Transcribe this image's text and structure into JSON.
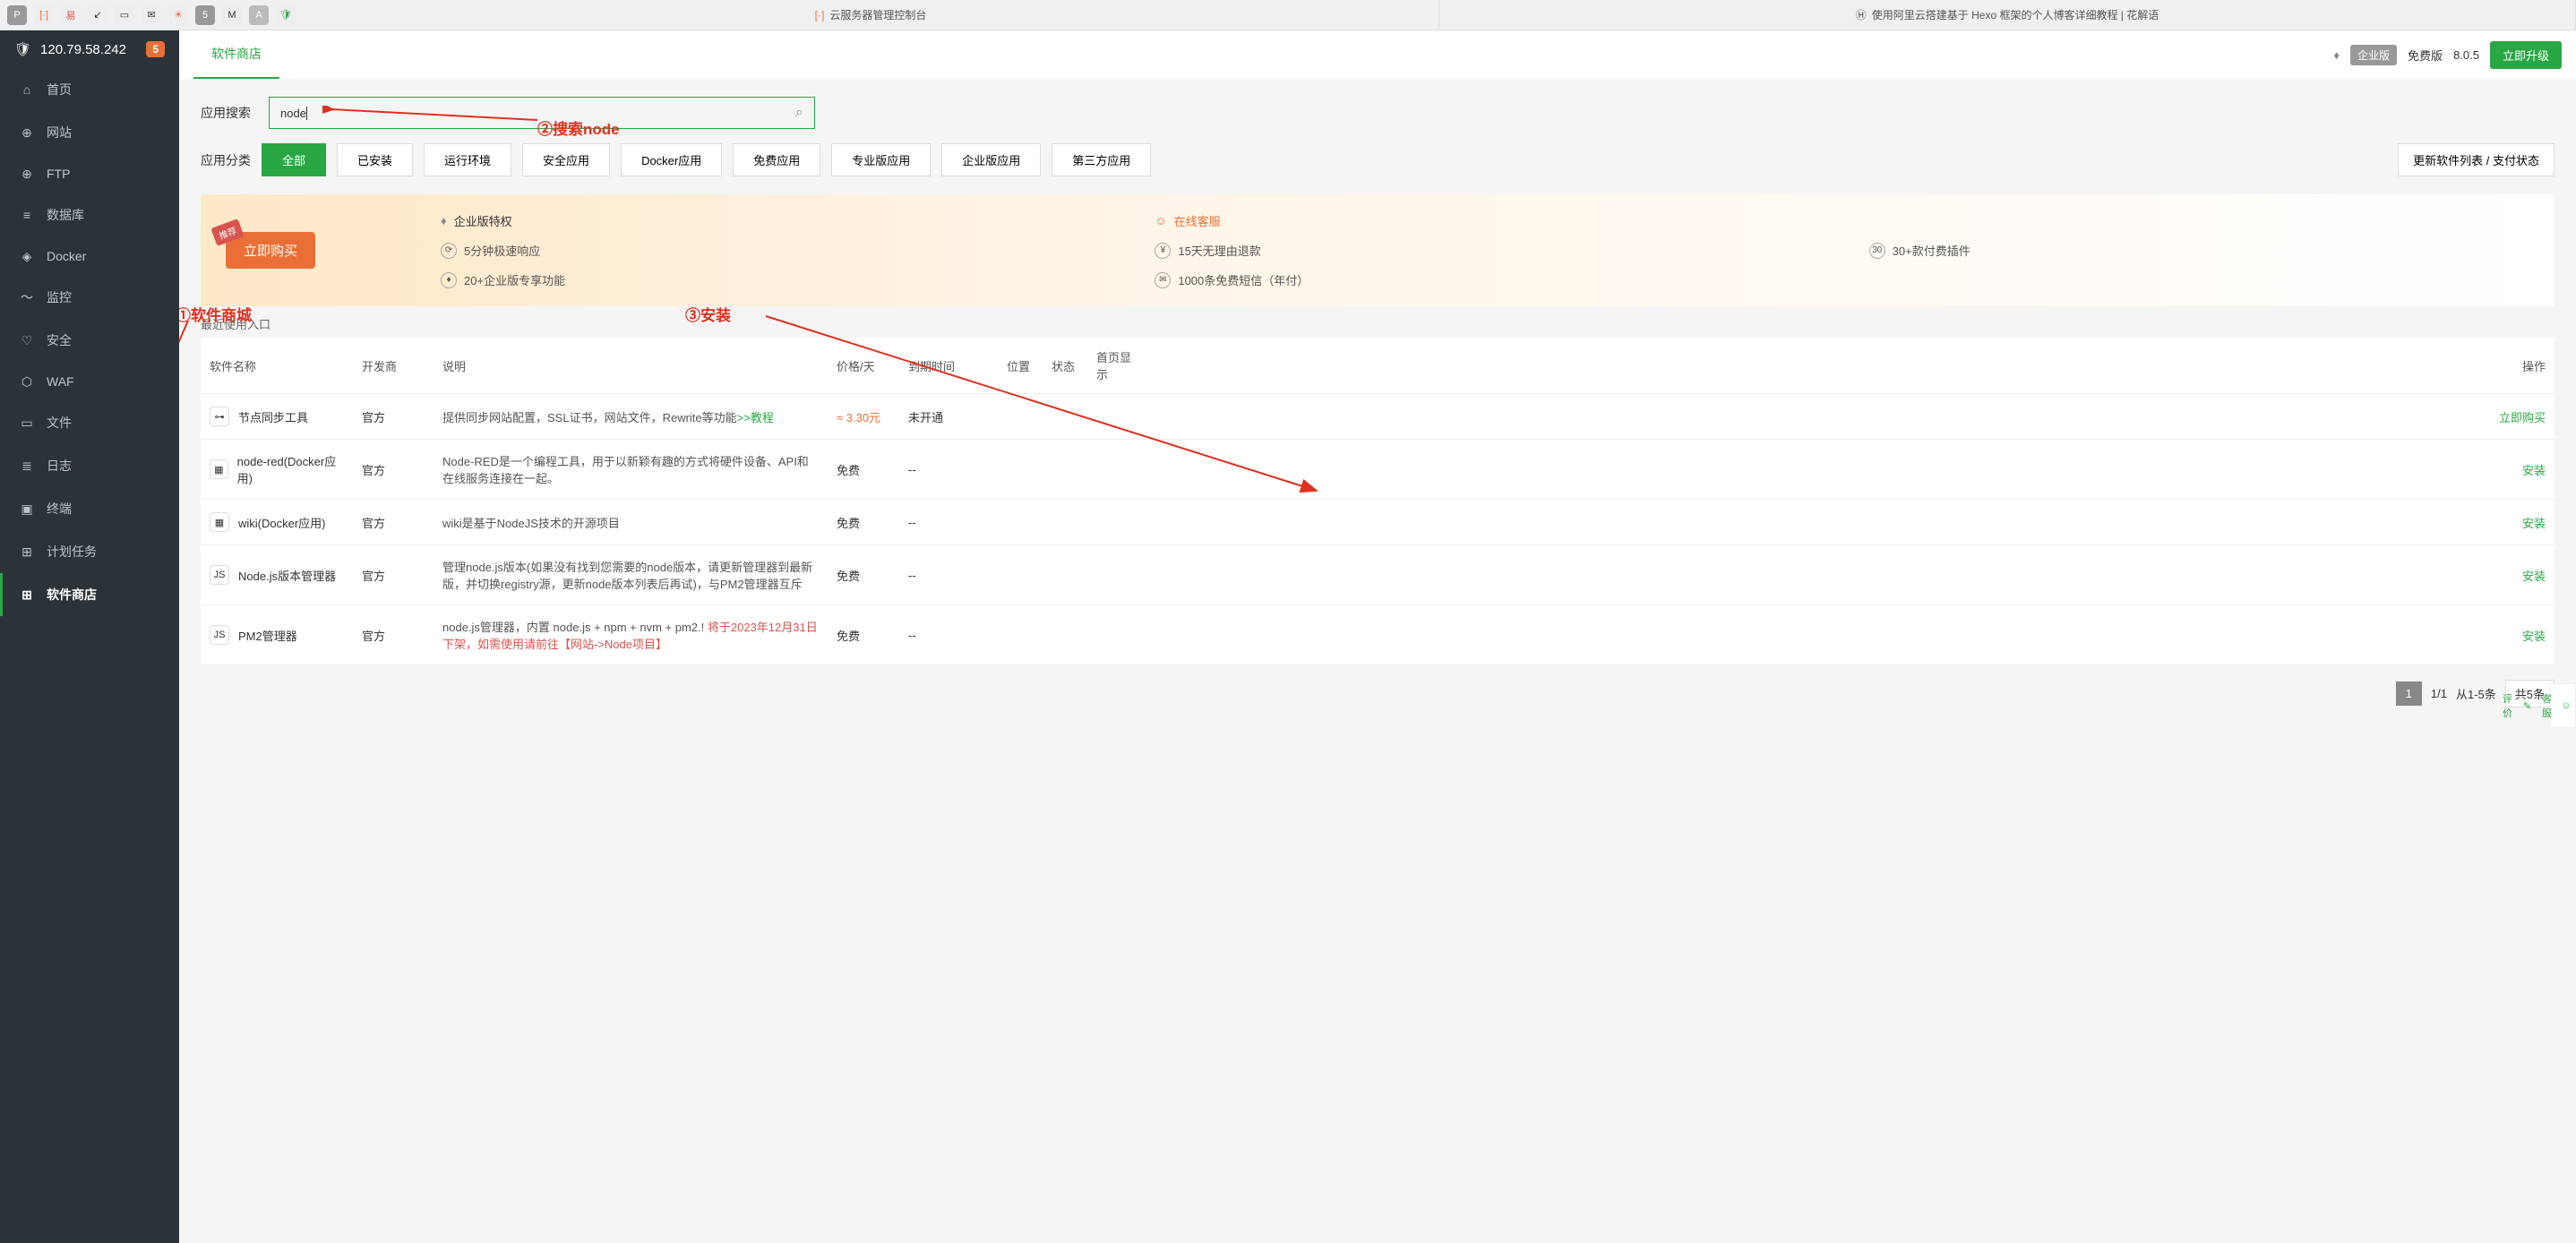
{
  "browser": {
    "tab1": "云服务器管理控制台",
    "tab2": "使用阿里云搭建基于 Hexo 框架的个人博客详细教程 | 花解语"
  },
  "sidebar": {
    "ip": "120.79.58.242",
    "badge": "5",
    "items": [
      {
        "icon": "⌂",
        "label": "首页"
      },
      {
        "icon": "⊕",
        "label": "网站"
      },
      {
        "icon": "⊕",
        "label": "FTP"
      },
      {
        "icon": "≡",
        "label": "数据库"
      },
      {
        "icon": "◈",
        "label": "Docker"
      },
      {
        "icon": "〜",
        "label": "监控"
      },
      {
        "icon": "♡",
        "label": "安全"
      },
      {
        "icon": "⬡",
        "label": "WAF"
      },
      {
        "icon": "▭",
        "label": "文件"
      },
      {
        "icon": "≣",
        "label": "日志"
      },
      {
        "icon": "▣",
        "label": "终端"
      },
      {
        "icon": "⊞",
        "label": "计划任务"
      },
      {
        "icon": "⊞",
        "label": "软件商店"
      }
    ]
  },
  "topbar": {
    "tab": "软件商店",
    "ent": "企业版",
    "free": "免费版",
    "version": "8.0.5",
    "upgrade": "立即升级"
  },
  "search": {
    "label": "应用搜索",
    "value": "node"
  },
  "categories": {
    "label": "应用分类",
    "items": [
      "全部",
      "已安装",
      "运行环境",
      "安全应用",
      "Docker应用",
      "免费应用",
      "专业版应用",
      "企业版应用",
      "第三方应用"
    ],
    "right": "更新软件列表 / 支付状态"
  },
  "promo": {
    "buy": "立即购买",
    "tag": "推荐",
    "head1": "企业版特权",
    "head2": "在线客服",
    "item1": "5分钟极速响应",
    "item2": "15天无理由退款",
    "item3": "30+款付费插件",
    "item4": "20+企业版专享功能",
    "item5": "1000条免费短信（年付）"
  },
  "recent_label": "最近使用入口",
  "annotations": {
    "a1": "①软件商城",
    "a2": "②搜索node",
    "a3": "③安装"
  },
  "table": {
    "headers": [
      "软件名称",
      "开发商",
      "说明",
      "价格/天",
      "到期时间",
      "位置",
      "状态",
      "首页显示",
      "操作"
    ],
    "rows": [
      {
        "icon": "⊶",
        "name": "节点同步工具",
        "dev": "官方",
        "desc": "提供同步网站配置，SSL证书，网站文件，Rewrite等功能",
        "desc_link": ">>教程",
        "price": "≈ 3.30元",
        "price_class": "price-orange",
        "expire": "未开通",
        "action": "立即购买"
      },
      {
        "icon": "▦",
        "name": "node-red(Docker应用)",
        "dev": "官方",
        "desc": "Node-RED是一个编程工具，用于以新颖有趣的方式将硬件设备、API和在线服务连接在一起。",
        "price": "免费",
        "expire": "--",
        "action": "安装"
      },
      {
        "icon": "▦",
        "name": "wiki(Docker应用)",
        "dev": "官方",
        "desc": "wiki是基于NodeJS技术的开源项目",
        "price": "免费",
        "expire": "--",
        "action": "安装"
      },
      {
        "icon": "JS",
        "name": "Node.js版本管理器",
        "dev": "官方",
        "desc": "管理node.js版本(如果没有找到您需要的node版本，请更新管理器到最新版，并切换registry源，更新node版本列表后再试)，与PM2管理器互斥",
        "price": "免费",
        "expire": "--",
        "action": "安装"
      },
      {
        "icon": "JS",
        "name": "PM2管理器",
        "dev": "官方",
        "desc": "node.js管理器，内置 node.js + npm + nvm + pm2.!",
        "desc_warn": "将于2023年12月31日下架，如需使用请前往【网站->Node项目】",
        "price": "免费",
        "expire": "--",
        "action": "安装"
      }
    ]
  },
  "pagination": {
    "page": "1",
    "total": "1/1",
    "range": "从1-5条",
    "count": "共5条"
  },
  "support": {
    "s1": "客服",
    "s2": "评价"
  }
}
